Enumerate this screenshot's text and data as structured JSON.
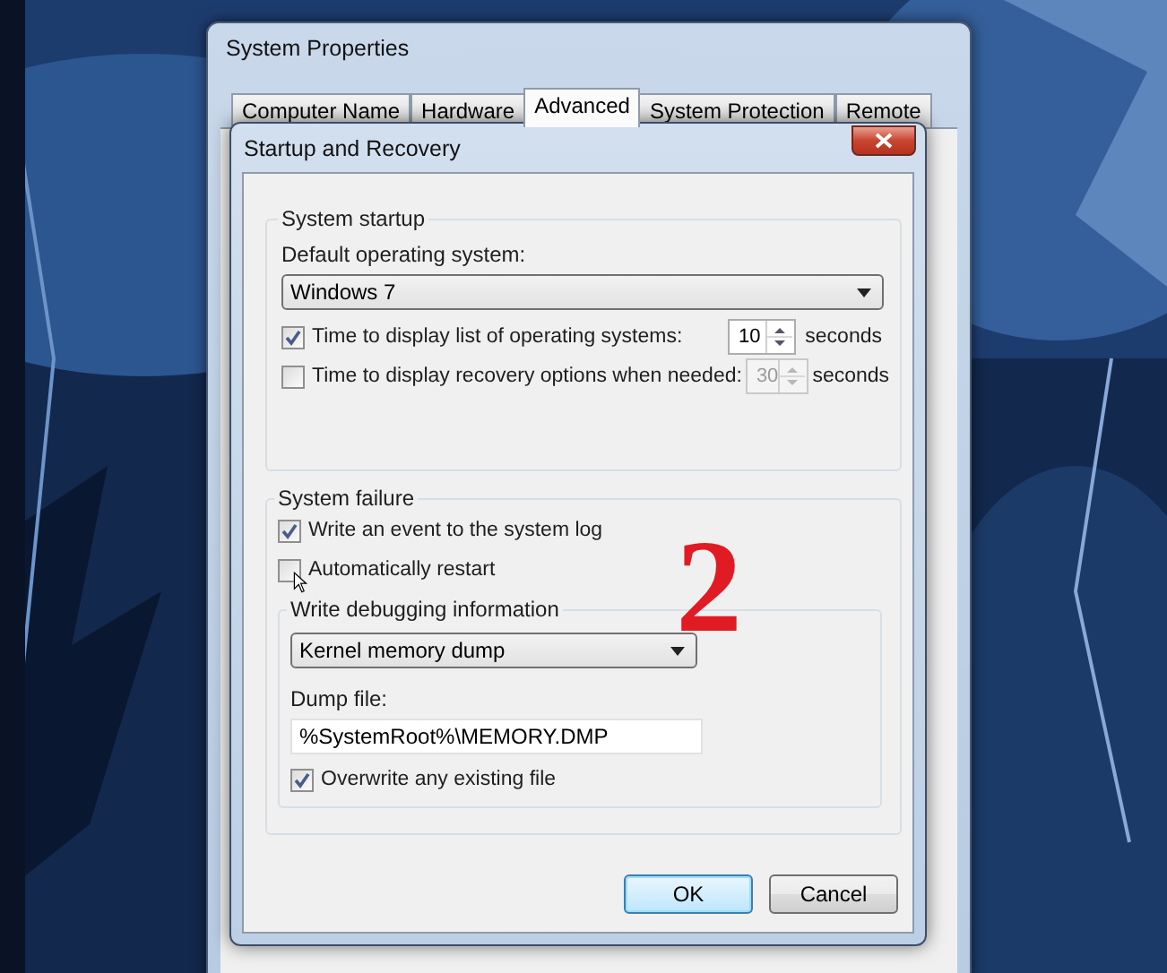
{
  "system_properties": {
    "title": "System Properties",
    "tabs": [
      {
        "label": "Computer Name",
        "selected": false
      },
      {
        "label": "Hardware",
        "selected": false
      },
      {
        "label": "Advanced",
        "selected": true
      },
      {
        "label": "System Protection",
        "selected": false
      },
      {
        "label": "Remote",
        "selected": false
      }
    ]
  },
  "startup_recovery": {
    "title": "Startup and Recovery",
    "system_startup": {
      "heading": "System startup",
      "default_os_label": "Default operating system:",
      "default_os": "Windows 7",
      "timeouts": [
        {
          "label": "Time to display list of operating systems:",
          "checked": true,
          "value": "10",
          "disabled": false,
          "unit": "seconds"
        },
        {
          "label": "Time to display recovery options when needed:",
          "checked": false,
          "value": "30",
          "disabled": true,
          "unit": "seconds"
        }
      ]
    },
    "system_failure": {
      "heading": "System failure",
      "options": [
        {
          "label": "Write an event to the system log",
          "checked": true
        },
        {
          "label": "Automatically restart",
          "checked": false
        }
      ],
      "debugging": {
        "heading": "Write debugging information",
        "selection": "Kernel memory dump",
        "dump_file_label": "Dump file:",
        "dump_file": "%SystemRoot%\\MEMORY.DMP",
        "overwrite": {
          "label": "Overwrite any existing file",
          "checked": true
        }
      }
    },
    "buttons": [
      {
        "label": "OK",
        "default": true
      },
      {
        "label": "Cancel",
        "default": false
      }
    ]
  },
  "annotation": "2"
}
